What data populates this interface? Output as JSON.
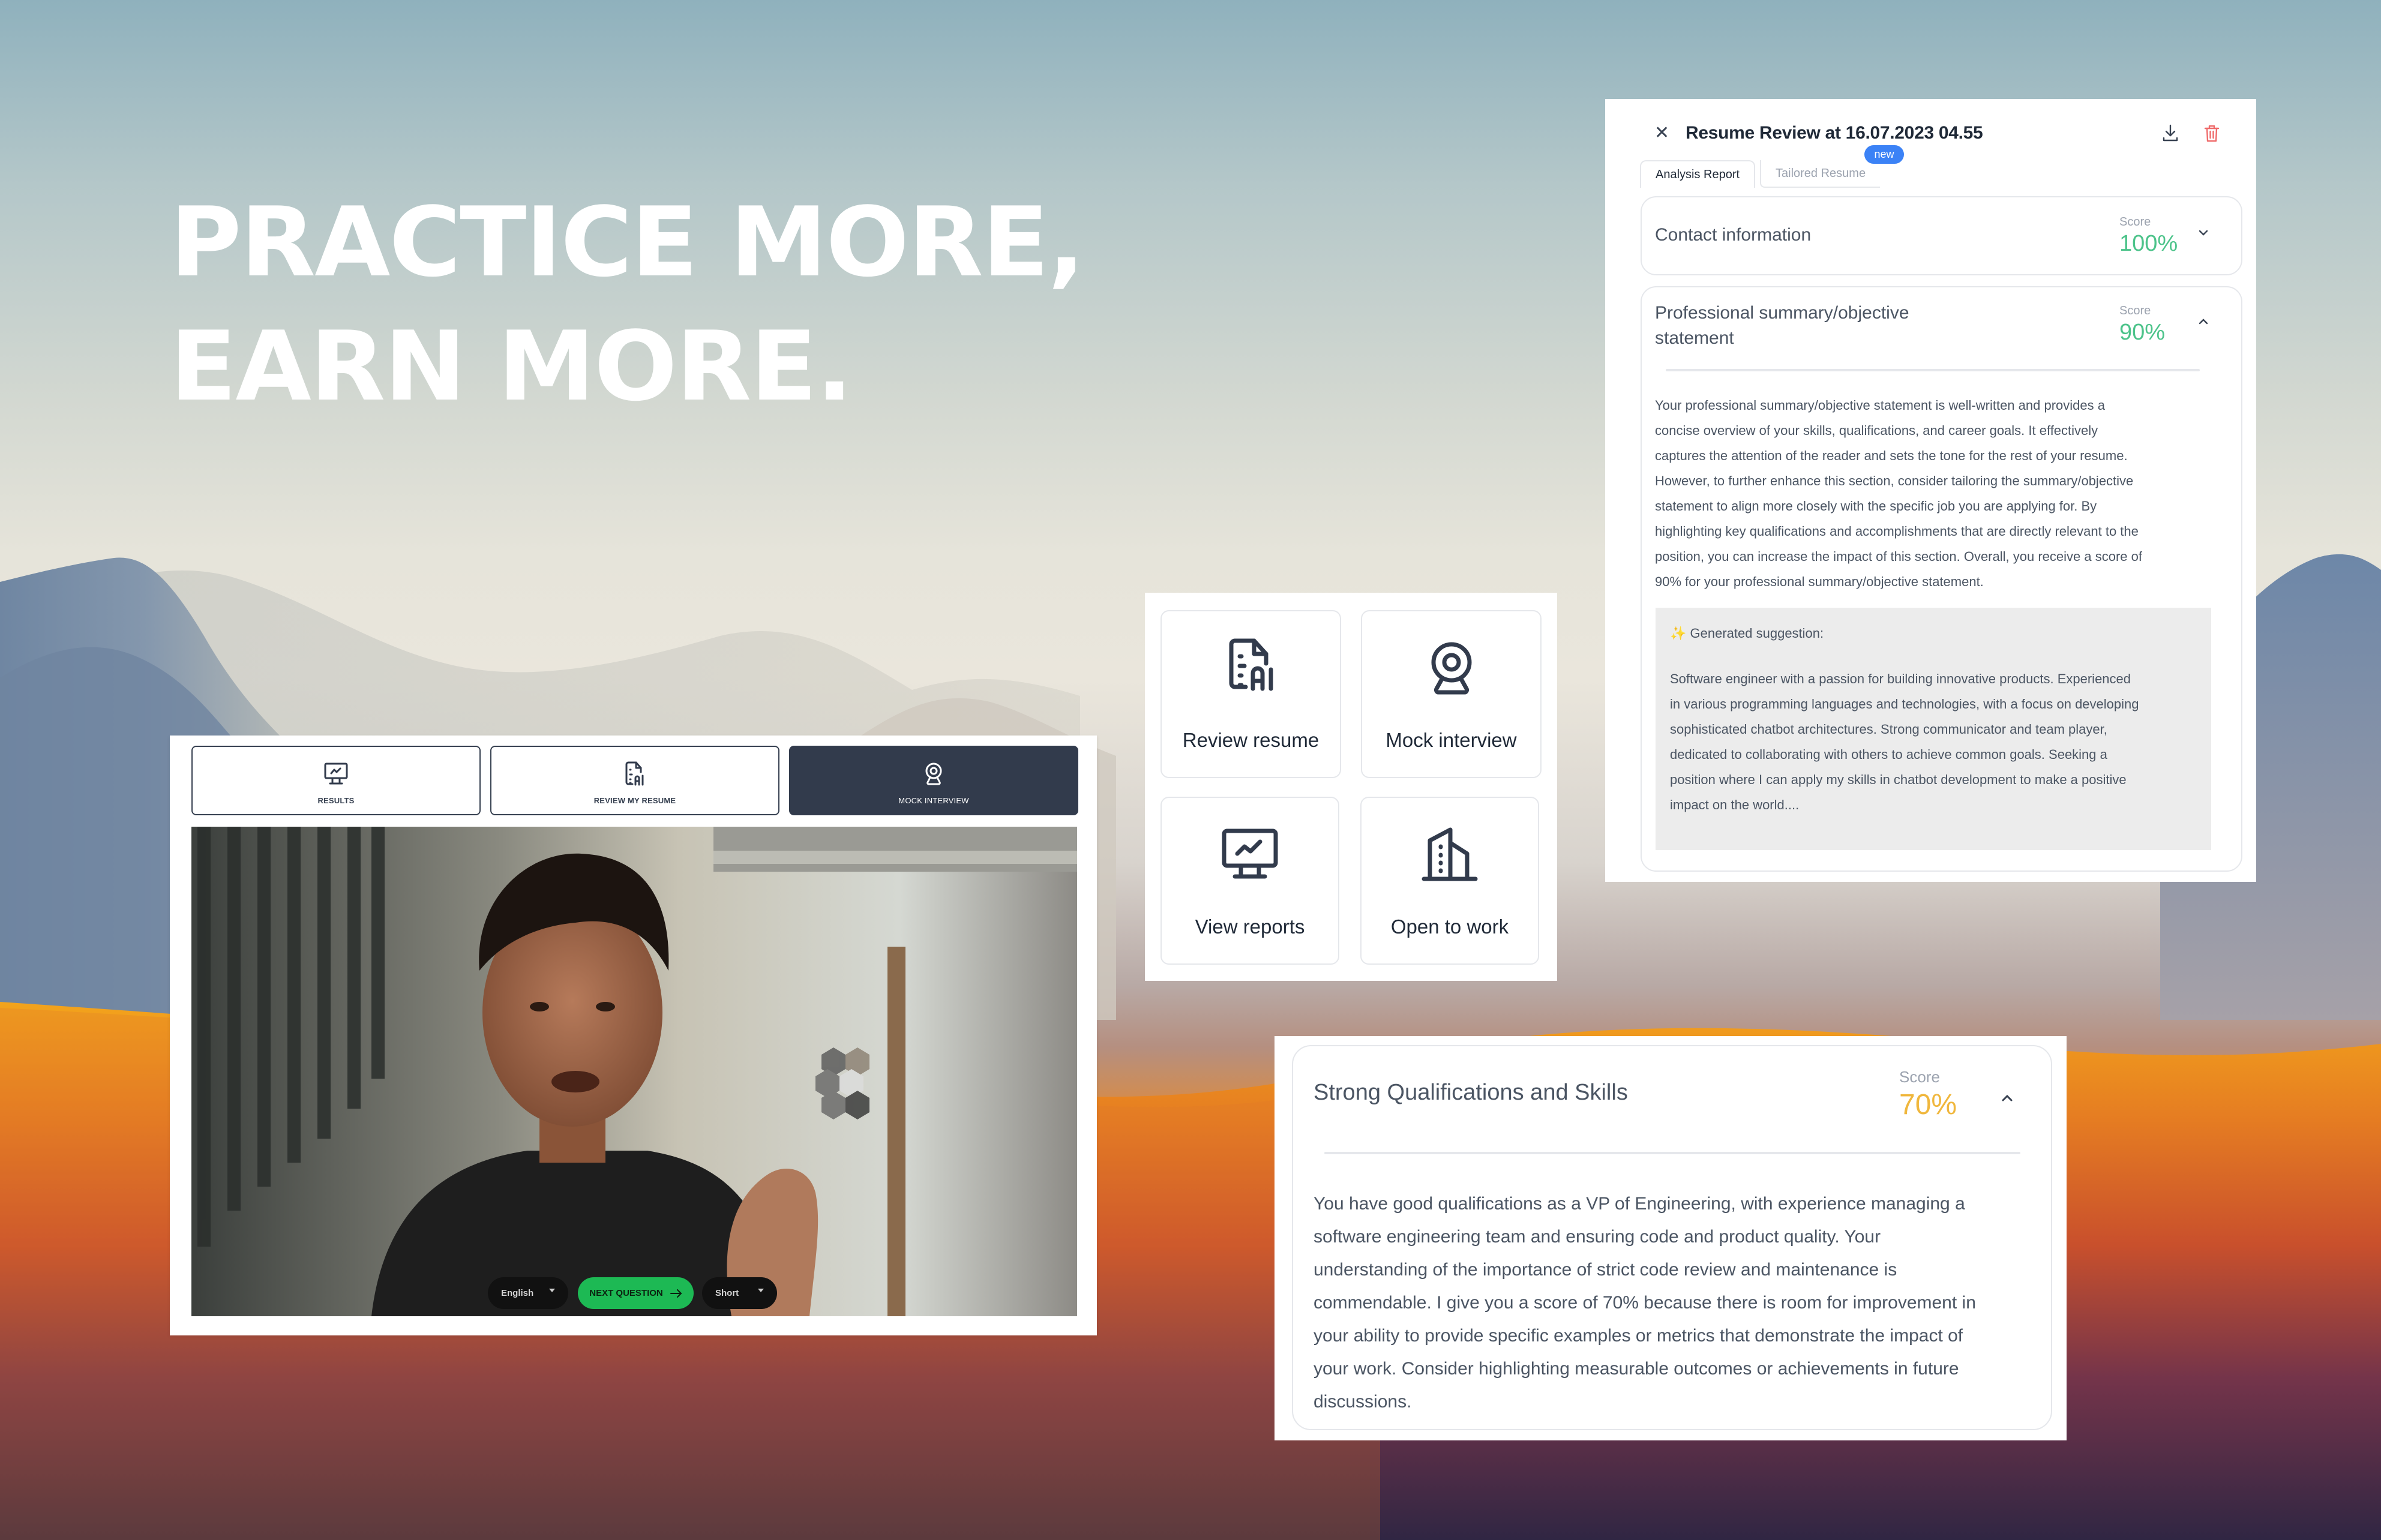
{
  "headline": {
    "line1": "PRACTICE MORE,",
    "line2": "EARN MORE."
  },
  "review_panel": {
    "title": "Resume Review at 16.07.2023 04.55",
    "close_icon": "close-icon",
    "download_icon": "download-icon",
    "delete_icon": "trash-icon",
    "tabs": [
      {
        "label": "Analysis Report",
        "active": true
      },
      {
        "label": "Tailored Resume",
        "active": false,
        "badge": "new"
      }
    ],
    "sections": [
      {
        "title": "Contact information",
        "score_label": "Score",
        "score": "100%",
        "score_color": "#4cc38a",
        "expanded": false
      },
      {
        "title": "Professional summary/objective statement",
        "title_line1": "Professional summary/objective",
        "title_line2": "statement",
        "score_label": "Score",
        "score": "90%",
        "score_color": "#4cc38a",
        "expanded": true,
        "body_lines": [
          "Your professional summary/objective statement is well-written and provides a",
          "concise overview of your skills, qualifications, and career goals. It effectively",
          "captures the attention of the reader and sets the tone for the rest of your resume.",
          "However, to further enhance this section, consider tailoring the summary/objective",
          "statement to align more closely with the specific job you are applying for. By",
          "highlighting key qualifications and accomplishments that are directly relevant to the",
          "position, you can increase the impact of this section. Overall, you receive a score of",
          "90% for your professional summary/objective statement."
        ],
        "suggestion": {
          "icon": "sparkles-icon",
          "heading": "Generated suggestion:",
          "lines": [
            "Software engineer with a passion for building innovative products. Experienced",
            "in various programming languages and technologies, with a focus on developing",
            "sophisticated chatbot architectures. Strong communicator and team player,",
            "dedicated to collaborating with others to achieve common goals. Seeking a",
            "position where I can apply my skills in chatbot development to make a positive",
            "impact on the world...."
          ]
        }
      }
    ]
  },
  "feature_grid": {
    "items": [
      {
        "label": "Review resume",
        "icon": "file-ai-icon"
      },
      {
        "label": "Mock interview",
        "icon": "webcam-icon"
      },
      {
        "label": "View reports",
        "icon": "monitor-chart-icon"
      },
      {
        "label": "Open to work",
        "icon": "building-icon"
      }
    ]
  },
  "interview_panel": {
    "tabs": [
      {
        "label": "RESULTS",
        "icon": "monitor-chart-icon",
        "active": false
      },
      {
        "label": "REVIEW MY RESUME",
        "icon": "file-ai-icon",
        "active": false
      },
      {
        "label": "MOCK INTERVIEW",
        "icon": "webcam-icon",
        "active": true
      }
    ],
    "controls": {
      "language": "English",
      "next_label": "NEXT QUESTION",
      "next_icon": "arrow-right-icon",
      "length": "Short"
    }
  },
  "qualification_panel": {
    "title": "Strong Qualifications and Skills",
    "score_label": "Score",
    "score": "70%",
    "score_color": "#f0b73d",
    "expanded": true,
    "body_lines": [
      "You have good qualifications as a VP of Engineering, with experience managing a",
      "software engineering team and ensuring code and product quality. Your",
      "understanding of the importance of strict code review and maintenance is",
      "commendable. I give you a score of 70% because there is room for improvement in",
      "your ability to provide specific examples or metrics that demonstrate the impact of",
      "your work. Consider highlighting measurable outcomes or achievements in future",
      "discussions."
    ]
  },
  "colors": {
    "ink": "#1f2937",
    "active_tab": "#323b4c",
    "green_button": "#1db954",
    "badge_blue": "#3b82f6",
    "delete_red": "#ef6b6b"
  }
}
